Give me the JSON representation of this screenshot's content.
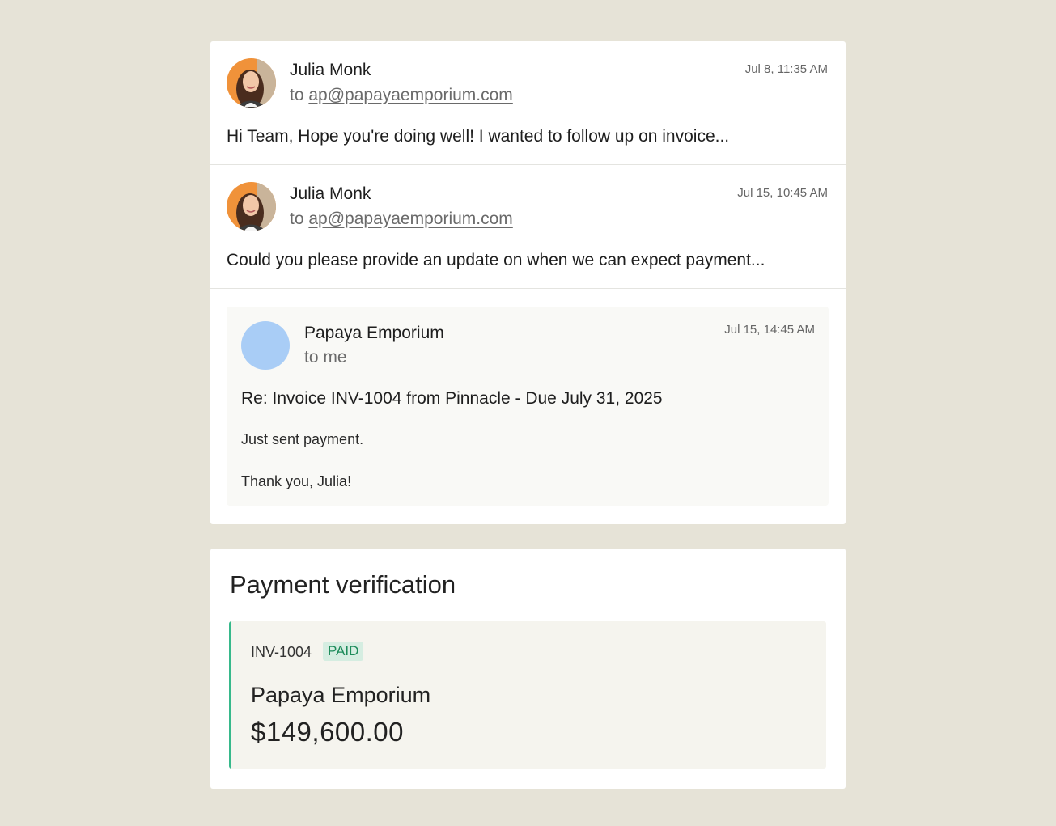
{
  "thread": {
    "messages": [
      {
        "sender": "Julia Monk",
        "to_prefix": "to",
        "to_address": "ap@papayaemporium.com",
        "time": "Jul 8, 11:35 AM",
        "snippet": "Hi Team, Hope you're doing well! I wanted to follow up on invoice..."
      },
      {
        "sender": "Julia Monk",
        "to_prefix": "to",
        "to_address": "ap@papayaemporium.com",
        "time": "Jul 15, 10:45 AM",
        "snippet": "Could you please provide an update on when we can expect payment..."
      }
    ],
    "reply": {
      "sender": "Papaya Emporium",
      "recipient": "to me",
      "time": "Jul 15, 14:45 AM",
      "subject": "Re: Invoice INV-1004 from Pinnacle - Due July 31, 2025",
      "body_line1": "Just sent payment.",
      "body_line2": "Thank you, Julia!",
      "avatar_color": "#a9cdf6"
    }
  },
  "verification": {
    "title": "Payment verification",
    "invoice_id": "INV-1004",
    "status": "PAID",
    "company": "Papaya Emporium",
    "amount": "$149,600.00",
    "accent_color": "#37b98b"
  }
}
